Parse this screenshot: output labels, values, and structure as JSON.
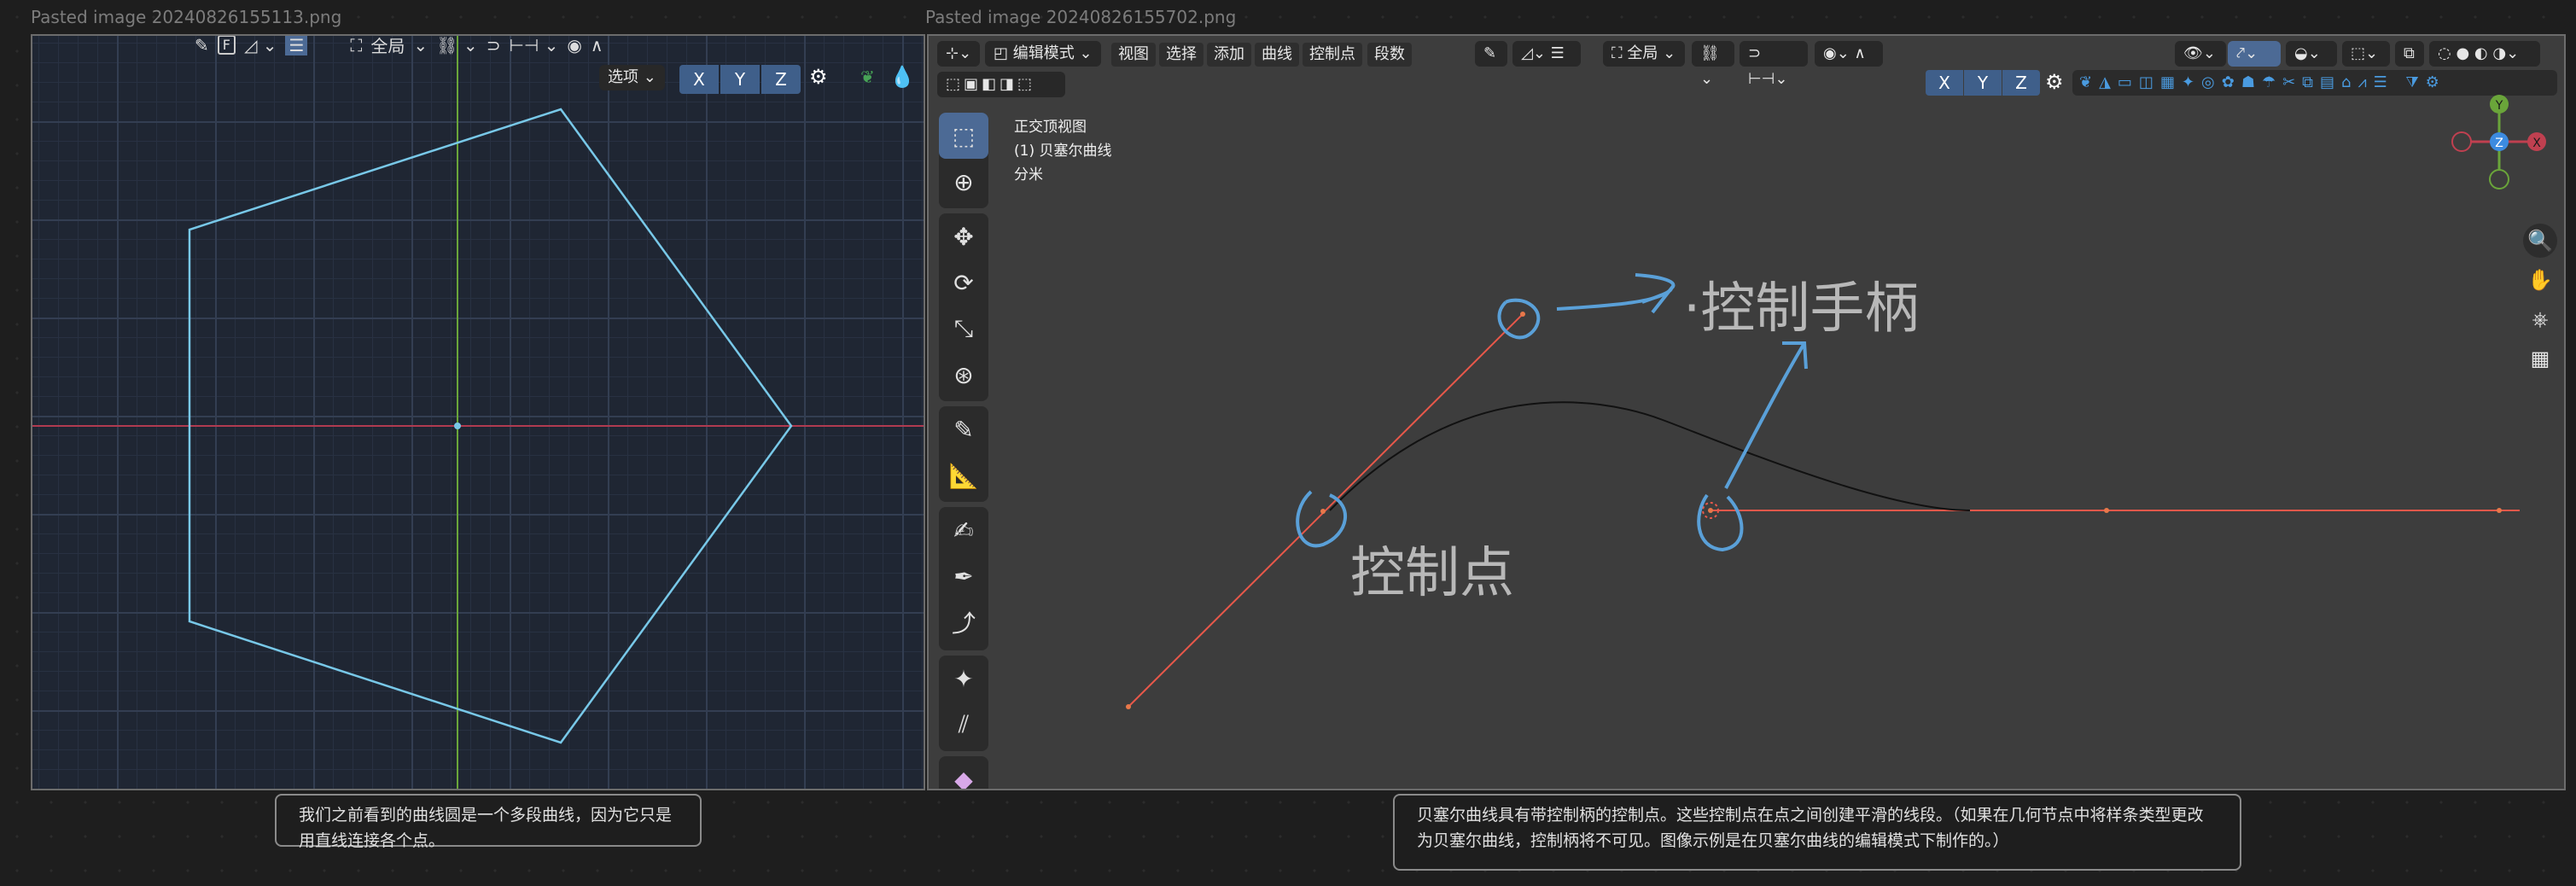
{
  "files": {
    "left": "Pasted image 20240826155113.png",
    "right": "Pasted image 20240826155702.png"
  },
  "left_viewport": {
    "header": {
      "global_label": "全局",
      "options_label": "选项",
      "axis_x": "X",
      "axis_y": "Y",
      "axis_z": "Z"
    },
    "colors": {
      "grid_bg": "#1f2633",
      "curve": "#78c8e8",
      "x_axis": "#b03a50",
      "y_axis": "#6aa53a"
    }
  },
  "left_caption": "我们之前看到的曲线圆是一个多段曲线，因为它只是用直线连接各个点。",
  "right_viewport": {
    "header": {
      "mode_label": "编辑模式",
      "menus": [
        "视图",
        "选择",
        "添加",
        "曲线",
        "控制点",
        "段数"
      ],
      "global_label": "全局",
      "axis_x": "X",
      "axis_y": "Y",
      "axis_z": "Z"
    },
    "info": {
      "view_name": "正交顶视图",
      "object_name": "(1) 贝塞尔曲线",
      "unit": "分米"
    },
    "gizmo": {
      "y": "Y",
      "z": "Z",
      "x": "X"
    },
    "annotations": {
      "handle_label": "·控制手柄",
      "point_label": "控制点"
    },
    "colors": {
      "bg": "#3d3d3d",
      "handle": "#e8584a",
      "annotation": "#5aa0d8",
      "curve": "#111111"
    }
  },
  "right_caption": "贝塞尔曲线具有带控制柄的控制点。这些控制点在点之间创建平滑的线段。（如果在几何节点中将样条类型更改为贝塞尔曲线，控制柄将不可见。图像示例是在贝塞尔曲线的编辑模式下制作的。）",
  "icons": [
    "eyedropper-icon",
    "select-box-icon",
    "cursor-icon",
    "move-icon",
    "rotate-icon",
    "scale-icon",
    "transform-icon",
    "annotate-icon",
    "measure-icon",
    "draw-icon",
    "pen-icon",
    "curve-icon",
    "radius-icon",
    "tilt-icon",
    "extrude-icon",
    "zoom-icon",
    "hand-icon",
    "camera-icon",
    "grid-icon",
    "gear-icon"
  ]
}
